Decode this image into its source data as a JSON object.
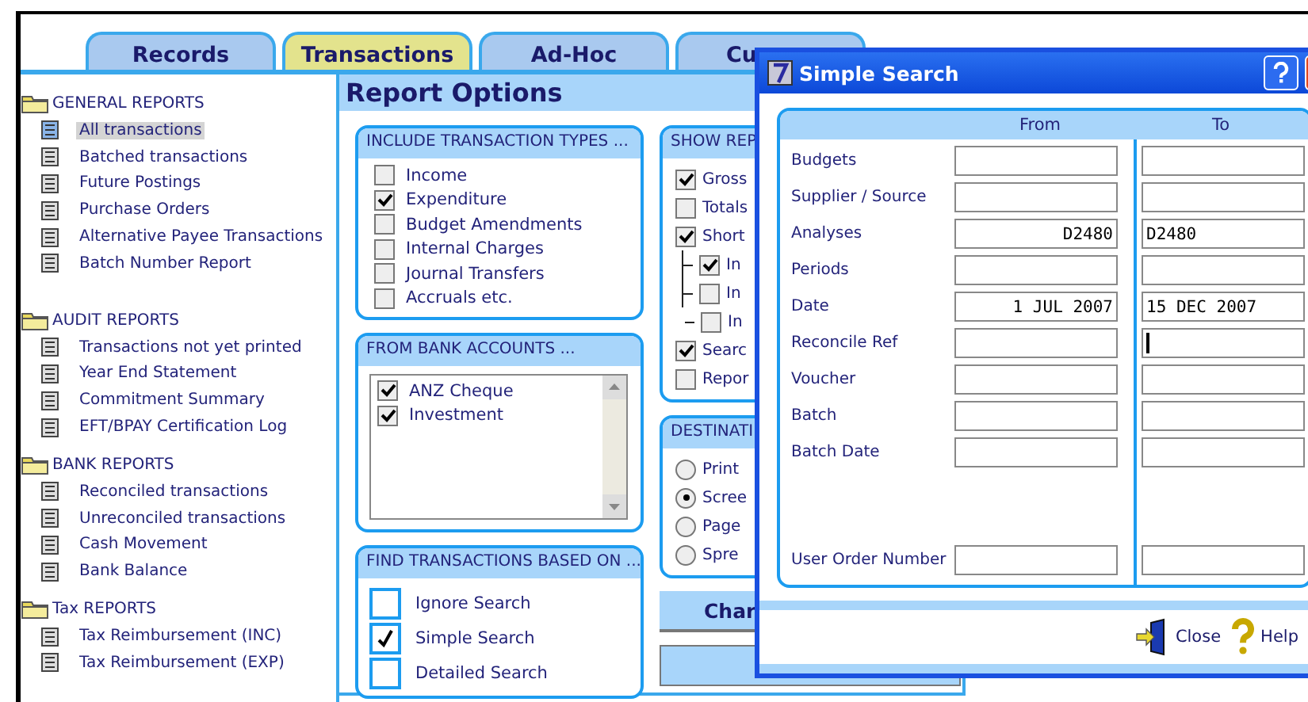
{
  "tabs": [
    {
      "label": "Records",
      "selected": false
    },
    {
      "label": "Transactions",
      "selected": true
    },
    {
      "label": "Ad-Hoc",
      "selected": false
    },
    {
      "label": "Cu",
      "selected": false
    }
  ],
  "sidebar": {
    "sections": [
      {
        "title": "GENERAL REPORTS",
        "items": [
          {
            "label": "All transactions",
            "selected": true
          },
          {
            "label": "Batched transactions",
            "selected": false
          },
          {
            "label": "Future Postings",
            "selected": false
          },
          {
            "label": "Purchase Orders",
            "selected": false
          },
          {
            "label": "Alternative Payee Transactions",
            "selected": false
          },
          {
            "label": "Batch Number Report",
            "selected": false
          }
        ]
      },
      {
        "title": "AUDIT REPORTS",
        "items": [
          {
            "label": "Transactions not yet printed",
            "selected": false
          },
          {
            "label": "Year End Statement",
            "selected": false
          },
          {
            "label": "Commitment Summary",
            "selected": false
          },
          {
            "label": "EFT/BPAY Certification Log",
            "selected": false
          }
        ]
      },
      {
        "title": "BANK REPORTS",
        "items": [
          {
            "label": "Reconciled transactions",
            "selected": false
          },
          {
            "label": "Unreconciled transactions",
            "selected": false
          },
          {
            "label": "Cash Movement",
            "selected": false
          },
          {
            "label": "Bank Balance",
            "selected": false
          }
        ]
      },
      {
        "title": "Tax  REPORTS",
        "items": [
          {
            "label": "Tax  Reimbursement (INC)",
            "selected": false
          },
          {
            "label": "Tax  Reimbursement (EXP)",
            "selected": false
          }
        ]
      }
    ]
  },
  "report_options": {
    "title": "Report Options",
    "transaction_types": {
      "title": "INCLUDE TRANSACTION TYPES ...",
      "items": [
        {
          "label": "Income",
          "checked": false
        },
        {
          "label": "Expenditure",
          "checked": true
        },
        {
          "label": "Budget Amendments",
          "checked": false
        },
        {
          "label": "Internal Charges",
          "checked": false
        },
        {
          "label": "Journal Transfers",
          "checked": false
        },
        {
          "label": "Accruals etc.",
          "checked": false
        }
      ]
    },
    "bank_accounts": {
      "title": "FROM BANK ACCOUNTS ...",
      "items": [
        {
          "label": "ANZ Cheque",
          "checked": true
        },
        {
          "label": "Investment",
          "checked": true
        }
      ]
    },
    "find_based_on": {
      "title": "FIND TRANSACTIONS BASED ON ...",
      "items": [
        {
          "label": "Ignore Search",
          "checked": false
        },
        {
          "label": "Simple Search",
          "checked": true
        },
        {
          "label": "Detailed Search",
          "checked": false
        }
      ]
    },
    "show_report": {
      "title": "SHOW REP",
      "items": [
        {
          "label": "Gross",
          "checked": true
        },
        {
          "label": "Totals",
          "checked": false
        },
        {
          "label": "Short",
          "checked": true,
          "children": [
            {
              "label": "In",
              "checked": true
            },
            {
              "label": "In",
              "checked": false
            },
            {
              "label": "In",
              "checked": false
            }
          ]
        },
        {
          "label": "Searc",
          "checked": true
        },
        {
          "label": "Repor",
          "checked": false
        }
      ]
    },
    "destination": {
      "title": "DESTINATI",
      "options": [
        {
          "label": "Print",
          "selected": false
        },
        {
          "label": "Scree",
          "selected": true
        },
        {
          "label": "Page",
          "selected": false
        },
        {
          "label": "Spre",
          "selected": false
        }
      ]
    },
    "buttons": [
      "Char"
    ]
  },
  "dialog": {
    "title": "Simple Search",
    "columns": [
      "From",
      "To"
    ],
    "rows": [
      {
        "label": "Budgets",
        "from": "",
        "to": "",
        "focused": false
      },
      {
        "label": "Supplier / Source",
        "from": "",
        "to": "",
        "focused": false
      },
      {
        "label": "Analyses",
        "from": "D2480",
        "to": "D2480",
        "focused": false
      },
      {
        "label": "Periods",
        "from": "",
        "to": "",
        "focused": false
      },
      {
        "label": "Date",
        "from": "1 JUL 2007",
        "to": "15 DEC 2007",
        "focused": false
      },
      {
        "label": "Reconcile Ref",
        "from": "",
        "to": "",
        "focused": true
      },
      {
        "label": "Voucher",
        "from": "",
        "to": "",
        "focused": false
      },
      {
        "label": "Batch",
        "from": "",
        "to": "",
        "focused": false
      },
      {
        "label": "Batch Date",
        "from": "",
        "to": "",
        "focused": false
      },
      {
        "label": "User Order Number",
        "from": "",
        "to": "",
        "focused": false
      }
    ],
    "footer": [
      "Close",
      "Help"
    ]
  }
}
